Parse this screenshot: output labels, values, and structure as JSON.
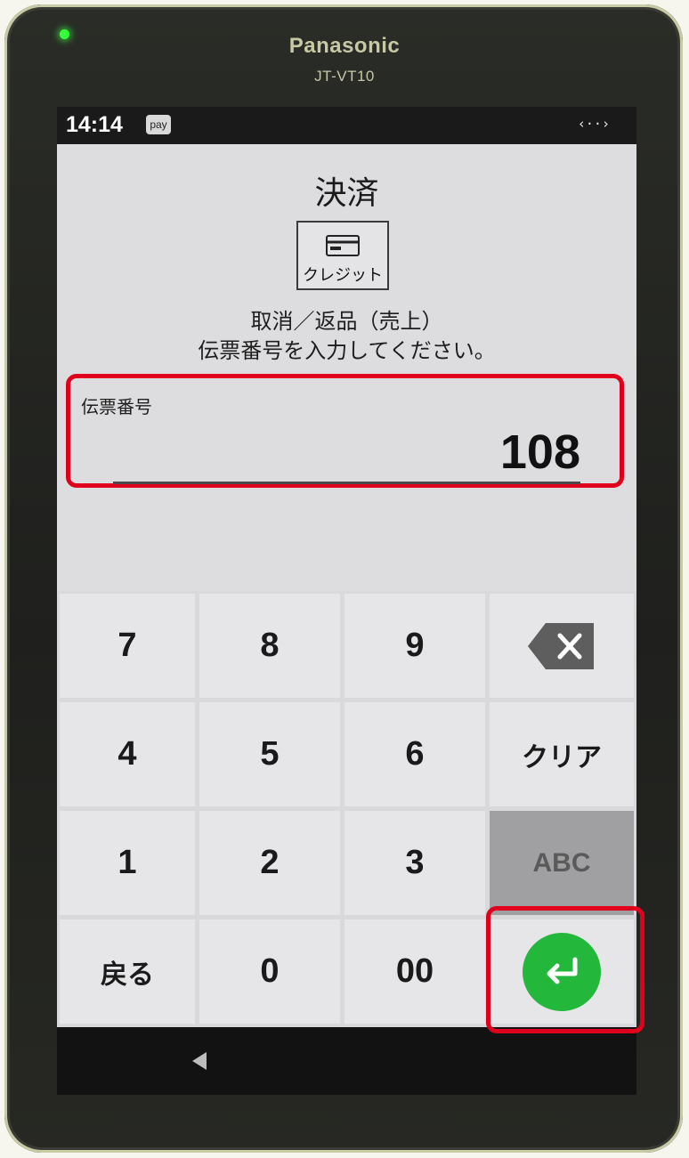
{
  "device": {
    "brand": "Panasonic",
    "model": "JT-VT10"
  },
  "status_bar": {
    "time": "14:14",
    "pay_badge": "pay",
    "sync_icon": "‹··›"
  },
  "screen": {
    "title": "決済",
    "method_label": "クレジット",
    "instruction_line1": "取消／返品（売上）",
    "instruction_line2": "伝票番号を入力してください。"
  },
  "field": {
    "label": "伝票番号",
    "value": "108"
  },
  "keypad": {
    "k7": "7",
    "k8": "8",
    "k9": "9",
    "k4": "4",
    "k5": "5",
    "k6": "6",
    "k1": "1",
    "k2": "2",
    "k3": "3",
    "back": "戻る",
    "k0": "0",
    "k00": "00",
    "clear": "クリア",
    "abc": "ABC"
  },
  "colors": {
    "highlight": "#e0001e",
    "enter": "#23b83c",
    "led": "#35ff3a"
  },
  "icons": {
    "backspace": "backspace-icon",
    "enter": "enter-return-icon",
    "card": "credit-card-icon",
    "nav_back": "nav-back-triangle-icon"
  }
}
